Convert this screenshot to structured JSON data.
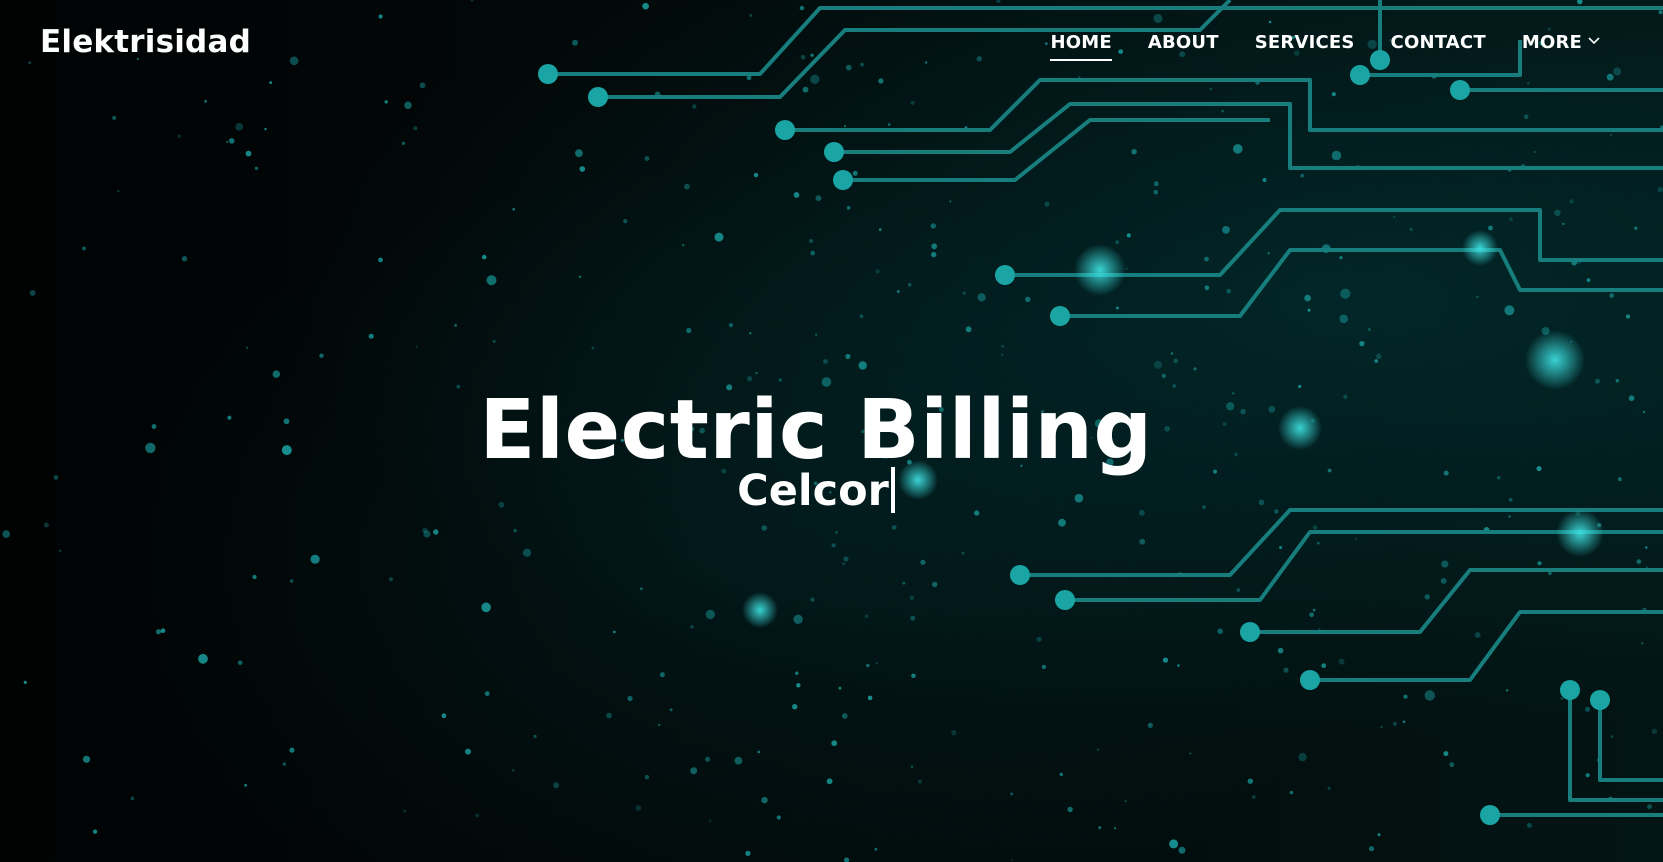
{
  "brand": {
    "name": "Elektrisidad"
  },
  "nav": {
    "items": [
      {
        "label": "HOME",
        "active": true
      },
      {
        "label": "ABOUT",
        "active": false
      },
      {
        "label": "SERVICES",
        "active": false
      },
      {
        "label": "CONTACT",
        "active": false
      },
      {
        "label": "MORE",
        "active": false,
        "dropdown": true
      }
    ]
  },
  "hero": {
    "title": "Electric Billing",
    "typed_text": "Celcor"
  },
  "theme": {
    "accent": "#1ba4a4",
    "trace": "#177d7d",
    "background": "#020a0a",
    "text": "#ffffff"
  }
}
